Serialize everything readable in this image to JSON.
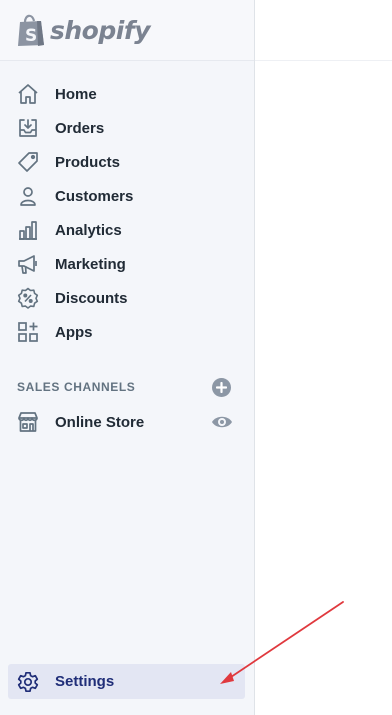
{
  "brand": {
    "name": "shopify",
    "logo_color": "#7b8391",
    "bag_color": "#8c94a2"
  },
  "nav": {
    "items": [
      {
        "label": "Home",
        "icon": "home-icon"
      },
      {
        "label": "Orders",
        "icon": "orders-icon"
      },
      {
        "label": "Products",
        "icon": "tag-icon"
      },
      {
        "label": "Customers",
        "icon": "person-icon"
      },
      {
        "label": "Analytics",
        "icon": "bar-chart-icon"
      },
      {
        "label": "Marketing",
        "icon": "megaphone-icon"
      },
      {
        "label": "Discounts",
        "icon": "discount-icon"
      },
      {
        "label": "Apps",
        "icon": "apps-icon"
      }
    ]
  },
  "sales_channels": {
    "title": "SALES CHANNELS",
    "add_icon": "plus-circle-icon",
    "items": [
      {
        "label": "Online Store",
        "icon": "store-icon",
        "action_icon": "eye-icon"
      }
    ]
  },
  "settings": {
    "label": "Settings",
    "icon": "gear-icon",
    "active_bg": "#e3e6f3",
    "active_color": "#202e78"
  },
  "annotation": {
    "arrow_color": "#e0393e"
  },
  "colors": {
    "sidebar_bg": "#f4f6fa",
    "text": "#212b36",
    "icon": "#637381"
  }
}
